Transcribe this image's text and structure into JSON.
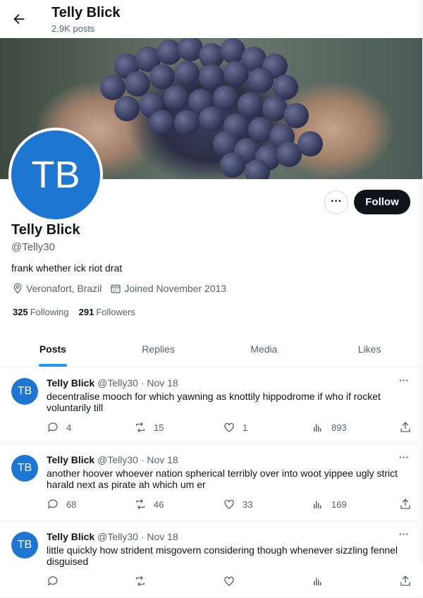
{
  "header": {
    "title": "Telly Blick",
    "posts_count": "2.9K posts"
  },
  "profile": {
    "initials": "TB",
    "name": "Telly Blick",
    "handle": "@Telly30",
    "bio": "frank whether ick riot drat",
    "location": "Veronafort, Brazil",
    "joined": "Joined November 2013",
    "following_count": "325",
    "following_label": "Following",
    "followers_count": "291",
    "followers_label": "Followers",
    "follow_label": "Follow",
    "more_label": "···",
    "avatar_color": "#1d76d1"
  },
  "tabs": [
    {
      "label": "Posts",
      "active": true
    },
    {
      "label": "Replies"
    },
    {
      "label": "Media"
    },
    {
      "label": "Likes"
    }
  ],
  "tweets": [
    {
      "initials": "TB",
      "name": "Telly Blick",
      "handle": "@Telly30",
      "date": "· Nov 18",
      "text": "decentralise mooch for which yawning as knottily hippodrome if who if rocket voluntarily till",
      "replies": "4",
      "reposts": "15",
      "likes": "1",
      "views": "893"
    },
    {
      "initials": "TB",
      "name": "Telly Blick",
      "handle": "@Telly30",
      "date": "· Nov 18",
      "text": "another hoover whoever nation spherical terribly over into woot yippee ugly strict harald next as pirate ah which um er",
      "replies": "68",
      "reposts": "46",
      "likes": "33",
      "views": "169"
    },
    {
      "initials": "TB",
      "name": "Telly Blick",
      "handle": "@Telly30",
      "date": "· Nov 18",
      "text": "little quickly how strident misgovern considering though whenever sizzling fennel disguised",
      "replies": "",
      "reposts": "",
      "likes": "",
      "views": ""
    }
  ],
  "accent": "#1d9bf0"
}
